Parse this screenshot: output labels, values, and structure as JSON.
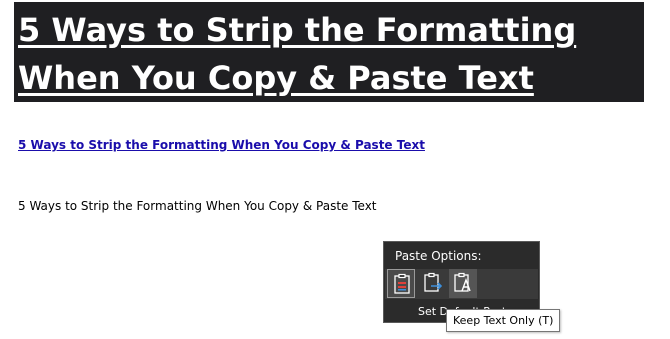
{
  "document": {
    "heading_line1": "5 Ways to Strip the Formatting",
    "heading_line2": "When You Copy & Paste Text",
    "link_text": "5 Ways to Strip the Formatting When You Copy & Paste Text",
    "plain_text": "5 Ways to Strip the Formatting When You Copy & Paste Text"
  },
  "paste_menu": {
    "title": "Paste Options:",
    "options": [
      {
        "icon": "keep-source-formatting-icon"
      },
      {
        "icon": "merge-formatting-icon"
      },
      {
        "icon": "keep-text-only-icon"
      }
    ],
    "set_default_label": "Set Default Paste..."
  },
  "tooltip": {
    "text": "Keep Text Only (T)"
  },
  "colors": {
    "heading_background": "#1f1f22",
    "link_color": "#1a0dab",
    "menu_background": "#2b2b2b",
    "accent_red": "#e0403a",
    "accent_blue": "#3c8fdc"
  }
}
